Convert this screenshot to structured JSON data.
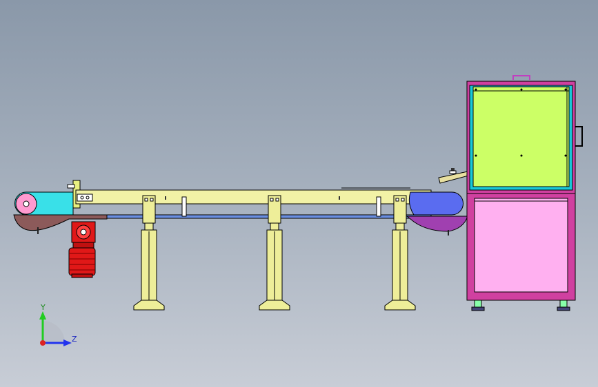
{
  "triad": {
    "y_label": "Y",
    "z_label": "Z",
    "y_color": "#22cc22",
    "z_color": "#2233ee",
    "x_color": "#dd2222"
  },
  "colors": {
    "background_top": "#8a98a9",
    "background_bottom": "#c8cdd6",
    "conveyor_frame": "#f2f2a6",
    "belt_blue": "#6a8ee0",
    "roller_cover": "#39e0e8",
    "drive_pulley": "#ff9ad0",
    "tray_brown": "#8c5a5a",
    "motor_red": "#e01818",
    "support_leg": "#eeee99",
    "discharge_guard": "#5a6cf0",
    "discharge_tray": "#a040b0",
    "cabinet_frame": "#d040a0",
    "cabinet_upper_panel": "#ccff66",
    "cabinet_lower_panel": "#ffb0f0",
    "cabinet_trim": "#18c8d8",
    "chute": "#e8e0a0"
  },
  "icons": [
    "coordinate-triad-icon"
  ]
}
